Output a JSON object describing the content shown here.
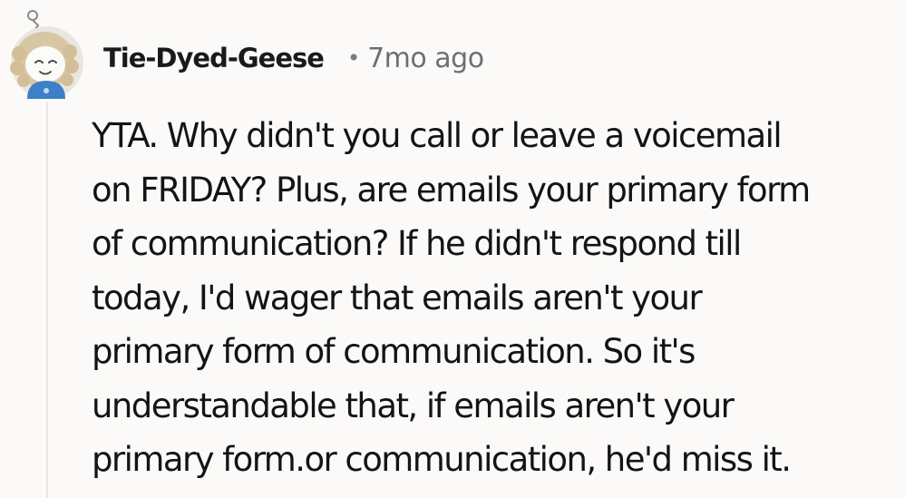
{
  "comment": {
    "author": "Tie-Dyed-Geese",
    "separator": "•",
    "timestamp": "7mo ago",
    "avatar_icon": "snoo-avatar-icon",
    "body_lines": [
      "YTA. Why didn't you call or leave a voicemail",
      "on FRIDAY? Plus, are emails your primary form",
      "of communication? If he didn't respond till",
      "today, I'd wager that emails aren't your",
      "primary form of communication. So it's",
      "understandable that, if emails aren't your",
      "primary form.or communication, he'd miss it."
    ]
  },
  "colors": {
    "background": "#fbfaf8",
    "thread_line": "#e7e6e3",
    "text": "#141414",
    "meta": "#6f6f6f",
    "avatar_shirt": "#3d7fc8"
  }
}
